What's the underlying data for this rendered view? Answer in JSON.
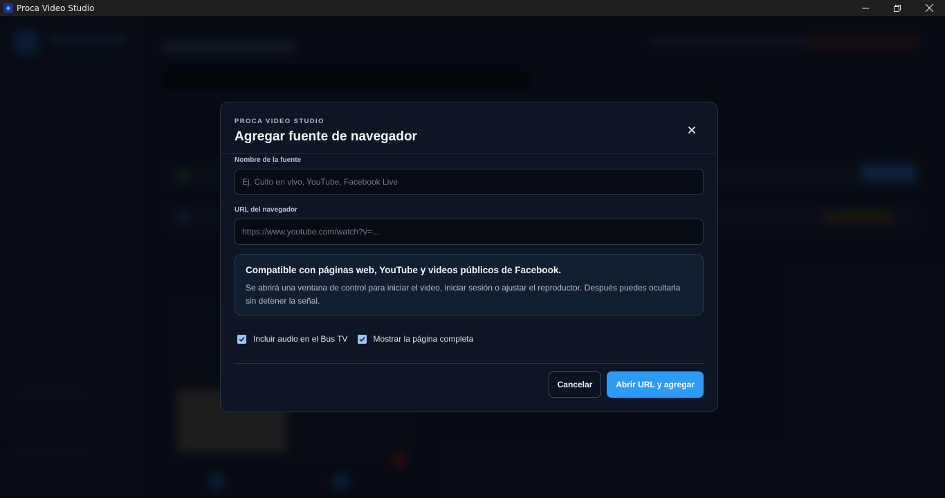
{
  "window": {
    "title": "Proca Video Studio",
    "app_icon_glyph": "◉"
  },
  "modal": {
    "eyebrow": "PROCA VIDEO STUDIO",
    "title": "Agregar fuente de navegador",
    "close_glyph": "✕",
    "fields": {
      "name": {
        "label": "Nombre de la fuente",
        "value": "",
        "placeholder": "Ej. Culto en vivo, YouTube, Facebook Live"
      },
      "url": {
        "label": "URL del navegador",
        "value": "",
        "placeholder": "https://www.youtube.com/watch?v=..."
      }
    },
    "info": {
      "title": "Compatible con páginas web, YouTube y videos públicos de Facebook.",
      "text": "Se abrirá una ventana de control para iniciar el video, iniciar sesión o ajustar el reproductor. Después puedes ocultarla sin detener la señal."
    },
    "options": [
      {
        "label": "Incluir audio en el Bus TV",
        "checked": true
      },
      {
        "label": "Mostrar la página completa",
        "checked": true
      }
    ],
    "buttons": {
      "cancel": "Cancelar",
      "primary": "Abrir URL y agregar"
    }
  },
  "colors": {
    "accent": "#2e9bf7",
    "modal_bg": "#0e1624",
    "info_bg": "#111d30"
  }
}
